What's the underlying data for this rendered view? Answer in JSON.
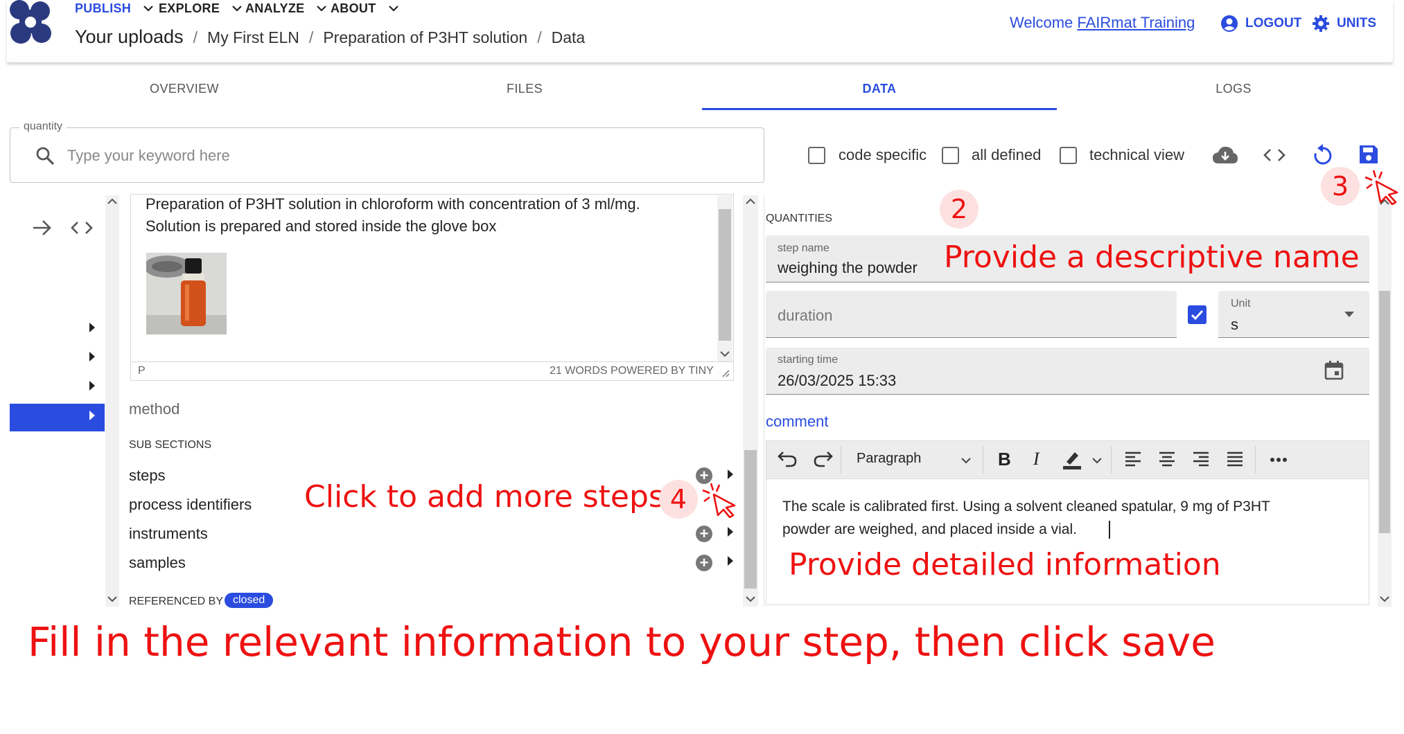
{
  "header": {
    "nav": [
      "PUBLISH",
      "EXPLORE",
      "ANALYZE",
      "ABOUT"
    ],
    "breadcrumb": [
      "Your uploads",
      "My First ELN",
      "Preparation of P3HT solution",
      "Data"
    ],
    "welcome_prefix": "Welcome ",
    "user_name": "FAIRmat Training",
    "logout_label": "LOGOUT",
    "units_label": "UNITS"
  },
  "tabs": [
    "OVERVIEW",
    "FILES",
    "DATA",
    "LOGS"
  ],
  "search": {
    "legend": "quantity",
    "placeholder": "Type your keyword here"
  },
  "filters": {
    "code_specific": "code specific",
    "all_defined": "all defined",
    "technical_view": "technical view"
  },
  "left_panel": {
    "description_lines": [
      "Preparation of P3HT solution in chloroform with concentration of 3 ml/mg.",
      "Solution is prepared and stored inside the glove box"
    ],
    "editor_status_left": "P",
    "editor_status_right": "21 WORDS  POWERED BY TINY",
    "method_label": "method",
    "subsections_heading": "SUB SECTIONS",
    "subsections": [
      "steps",
      "process identifiers",
      "instruments",
      "samples"
    ],
    "referenced_by_label": "REFERENCED BY",
    "referenced_by_badge": "closed"
  },
  "right_panel": {
    "quantities_heading": "QUANTITIES",
    "step_name": {
      "label": "step name",
      "value": "weighing the powder"
    },
    "duration": {
      "placeholder": "duration",
      "checked": true
    },
    "unit": {
      "label": "Unit",
      "value": "s"
    },
    "starting_time": {
      "label": "starting time",
      "value": "26/03/2025 15:33"
    },
    "comment_label": "comment",
    "toolbar": {
      "block_format": "Paragraph"
    },
    "comment_lines": [
      "The scale is calibrated first. Using a solvent cleaned spatular, 9 mg of P3HT",
      "powder are weighed, and placed inside a vial."
    ]
  },
  "annotations": {
    "num_2": "2",
    "num_3": "3",
    "num_4": "4",
    "name_hint": "Provide a descriptive name",
    "steps_hint": "Click to add more steps",
    "detail_hint": "Provide detailed information",
    "main_instruction": "Fill in the relevant information to your step, then click save"
  },
  "colors": {
    "brand_blue": "#2a4cdf",
    "logo_navy": "#2b3a80",
    "annotation_red": "#ee1111",
    "vial_orange": "#d2501a"
  },
  "icons": [
    "nomad-logo",
    "chevron-down-icon",
    "account-circle-icon",
    "gear-icon",
    "search-icon",
    "cloud-download-icon",
    "code-icon",
    "refresh-icon",
    "save-icon",
    "arrow-right-icon",
    "caret-right-icon",
    "plus-circle-icon",
    "calendar-icon",
    "undo-icon",
    "redo-icon",
    "bold-icon",
    "italic-icon",
    "highlight-icon",
    "align-left-icon",
    "align-center-icon",
    "align-right-icon",
    "justify-icon",
    "more-icon",
    "cursor-click-icon"
  ]
}
